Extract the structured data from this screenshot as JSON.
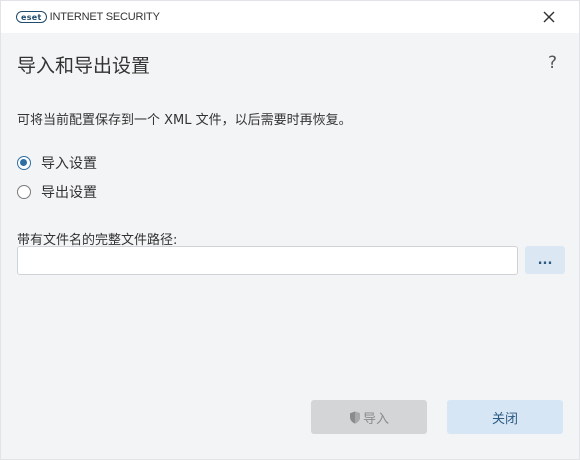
{
  "titlebar": {
    "logo_badge": "eset",
    "product_name": "INTERNET SECURITY"
  },
  "dialog": {
    "title": "导入和导出设置",
    "help_label": "?",
    "description": "可将当前配置保存到一个 XML 文件，以后需要时再恢复。",
    "options": [
      {
        "label": "导入设置",
        "selected": true
      },
      {
        "label": "导出设置",
        "selected": false
      }
    ],
    "path_label": "带有文件名的完整文件路径:",
    "path_value": "",
    "browse_label": "...",
    "import_label": "导入",
    "close_label": "关闭"
  },
  "colors": {
    "accent": "#2d6ea3",
    "background": "#f3f4f6",
    "disabled_button": "#d4d5d7",
    "secondary_button": "#d6e6f4"
  },
  "icons": {
    "close": "close-icon",
    "help": "help-icon",
    "import": "shield-icon"
  }
}
